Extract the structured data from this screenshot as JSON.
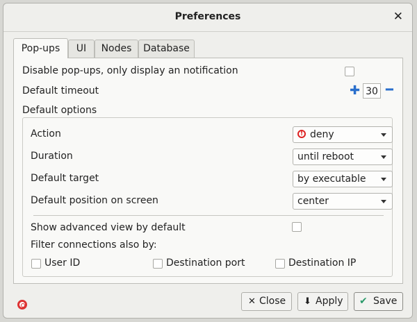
{
  "window": {
    "title": "Preferences"
  },
  "tabs": [
    {
      "label": "Pop-ups",
      "active": true
    },
    {
      "label": "UI",
      "active": false
    },
    {
      "label": "Nodes",
      "active": false
    },
    {
      "label": "Database",
      "active": false
    }
  ],
  "popups": {
    "disable_label": "Disable pop-ups, only display an notification",
    "disable_checked": false,
    "timeout_label": "Default timeout",
    "timeout_value": "30",
    "default_options_label": "Default options",
    "action_label": "Action",
    "action_value": "deny",
    "duration_label": "Duration",
    "duration_value": "until reboot",
    "target_label": "Default target",
    "target_value": "by executable",
    "position_label": "Default position on screen",
    "position_value": "center",
    "advanced_label": "Show advanced view by default",
    "filter_label": "Filter connections also by:",
    "filter_user_id": "User ID",
    "filter_dest_port": "Destination port",
    "filter_dest_ip": "Destination IP"
  },
  "buttons": {
    "close": "Close",
    "apply": "Apply",
    "save": "Save"
  },
  "colors": {
    "accent": "#2a6fcc",
    "deny": "#dd2222",
    "save_icon": "#2a9a6a"
  }
}
